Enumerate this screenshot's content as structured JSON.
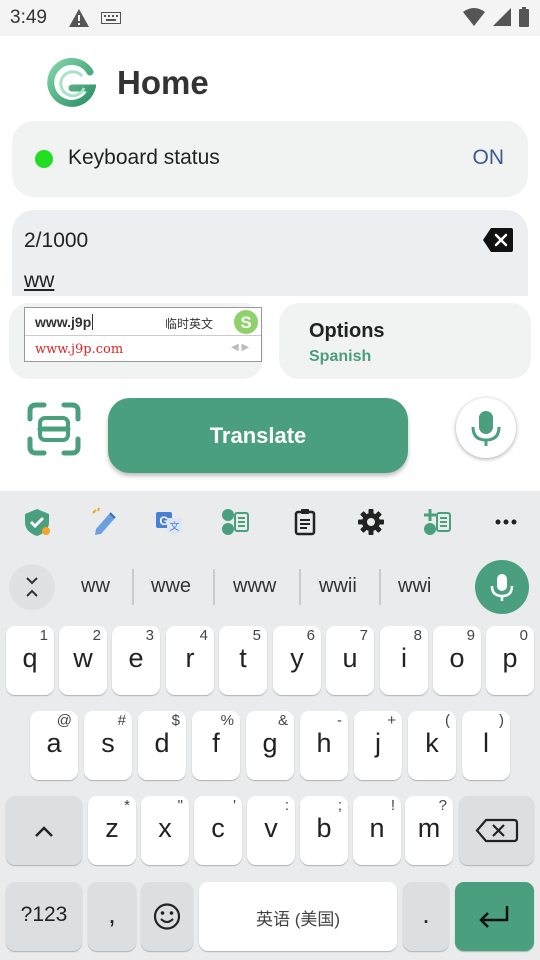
{
  "status_bar": {
    "time": "3:49"
  },
  "header": {
    "title": "Home"
  },
  "keyboard_status": {
    "label": "Keyboard status",
    "value": "ON"
  },
  "input": {
    "char_count": "2/1000",
    "text": "ww"
  },
  "url_popup": {
    "typed": "www.j9p",
    "mode": "临时英文",
    "suggestion": "www.j9p.com"
  },
  "options": {
    "label": "Options",
    "language": "Spanish"
  },
  "translate_label": "Translate",
  "suggestions": [
    "ww",
    "wwe",
    "www",
    "wwii",
    "wwi"
  ],
  "keys": {
    "row1": [
      {
        "k": "q",
        "h": "1"
      },
      {
        "k": "w",
        "h": "2"
      },
      {
        "k": "e",
        "h": "3"
      },
      {
        "k": "r",
        "h": "4"
      },
      {
        "k": "t",
        "h": "5"
      },
      {
        "k": "y",
        "h": "6"
      },
      {
        "k": "u",
        "h": "7"
      },
      {
        "k": "i",
        "h": "8"
      },
      {
        "k": "o",
        "h": "9"
      },
      {
        "k": "p",
        "h": "0"
      }
    ],
    "row2": [
      {
        "k": "a",
        "h": "@"
      },
      {
        "k": "s",
        "h": "#"
      },
      {
        "k": "d",
        "h": "$"
      },
      {
        "k": "f",
        "h": "%"
      },
      {
        "k": "g",
        "h": "&"
      },
      {
        "k": "h",
        "h": "-"
      },
      {
        "k": "j",
        "h": "+"
      },
      {
        "k": "k",
        "h": "("
      },
      {
        "k": "l",
        "h": ")"
      }
    ],
    "row3": [
      {
        "k": "z",
        "h": "*"
      },
      {
        "k": "x",
        "h": "\""
      },
      {
        "k": "c",
        "h": "'"
      },
      {
        "k": "v",
        "h": ":"
      },
      {
        "k": "b",
        "h": ";"
      },
      {
        "k": "n",
        "h": "!"
      },
      {
        "k": "m",
        "h": "?"
      }
    ],
    "symbols_label": "?123",
    "comma": ",",
    "space_label": "英语 (美国)",
    "period": "."
  },
  "colors": {
    "accent": "#4aa07e",
    "status_on": "#3d5a8a",
    "dot": "#22dd22"
  }
}
